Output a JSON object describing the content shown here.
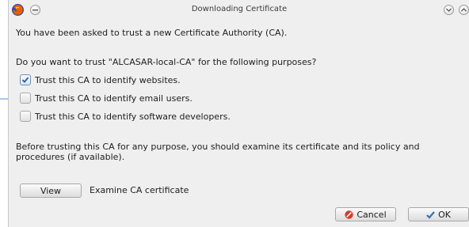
{
  "window": {
    "title": "Downloading Certificate"
  },
  "dialog": {
    "intro": "You have been asked to trust a new Certificate Authority (CA).",
    "question": "Do you want to trust \"ALCASAR-local-CA\" for the following purposes?",
    "options": [
      {
        "label": "Trust this CA to identify websites.",
        "checked": true
      },
      {
        "label": "Trust this CA to identify email users.",
        "checked": false
      },
      {
        "label": "Trust this CA to identify software developers.",
        "checked": false
      }
    ],
    "warning_line1": "Before trusting this CA for any purpose, you should examine its certificate and its policy and",
    "warning_line2": "procedures (if available).",
    "view_button": "View",
    "view_description": "Examine CA certificate",
    "cancel_button": "Cancel",
    "ok_button": "OK"
  },
  "icons": {
    "app": "firefox-icon",
    "window_menu": "window-menu-icon",
    "minimize": "minimize-icon",
    "maximize": "maximize-icon",
    "cancel": "cancel-icon",
    "ok": "checkmark-icon",
    "pointer": "arrow-pointer-icon"
  },
  "colors": {
    "window_bg": "#efefef",
    "check_accent": "#2f5f9e",
    "cancel_icon": "#d93a2b",
    "ok_icon": "#3b6fb0",
    "pointer": "#4a90d9"
  }
}
